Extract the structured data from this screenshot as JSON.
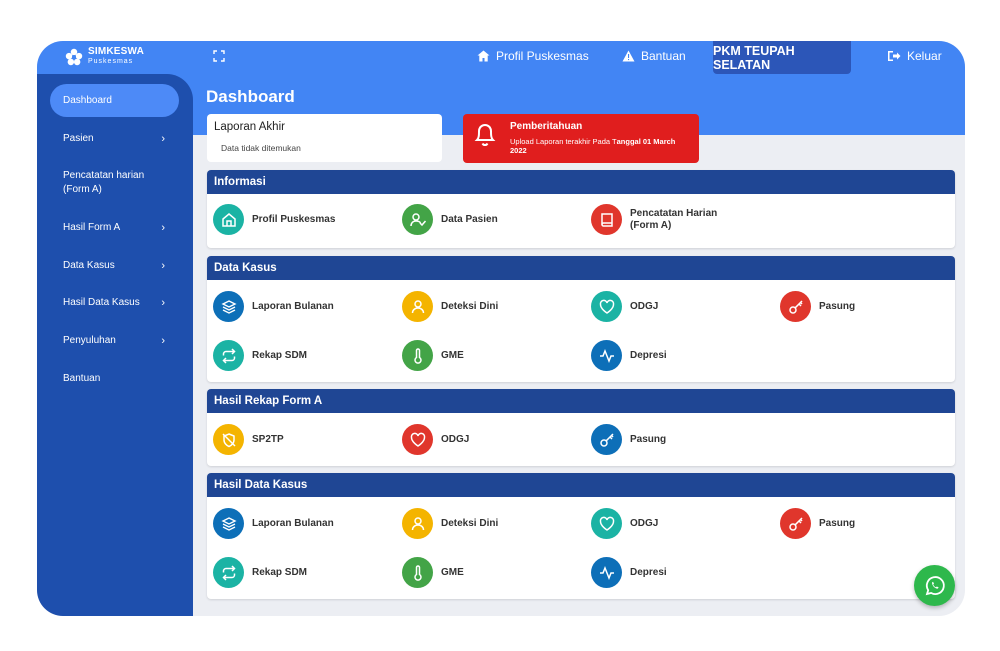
{
  "header": {
    "brand_title": "SIMKESWA",
    "brand_sub": "Puskesmas",
    "nav_profil": "Profil Puskesmas",
    "nav_bantuan": "Bantuan",
    "pkm": "PKM TEUPAH SELATAN",
    "nav_keluar": "Keluar"
  },
  "sidebar": {
    "items": [
      {
        "label": "Dashboard"
      },
      {
        "label": "Pasien"
      },
      {
        "label": "Pencatatan harian\n(Form A)"
      },
      {
        "label": "Hasil Form A"
      },
      {
        "label": "Data Kasus"
      },
      {
        "label": "Hasil Data Kasus"
      },
      {
        "label": "Penyuluhan"
      },
      {
        "label": "Bantuan"
      }
    ],
    "chevron": "›"
  },
  "main": {
    "title": "Dashboard",
    "laporan": {
      "title": "Laporan Akhir",
      "text": "Data tidak ditemukan"
    },
    "notif": {
      "title": "Pemberitahuan",
      "text_a": "Upload Laporan terakhir Pada T",
      "text_b": "anggal 01 March 2022"
    }
  },
  "panels": {
    "informasi": {
      "title": "Informasi",
      "items": [
        "Profil Puskesmas",
        "Data Pasien",
        "Pencatatan Harian\n(Form A)"
      ]
    },
    "data_kasus": {
      "title": "Data Kasus",
      "items": [
        "Laporan Bulanan",
        "Deteksi Dini",
        "ODGJ",
        "Pasung",
        "Rekap SDM",
        "GME",
        "Depresi"
      ]
    },
    "rekap_form_a": {
      "title": "Hasil Rekap Form A",
      "items": [
        "SP2TP",
        "ODGJ",
        "Pasung"
      ]
    },
    "hasil_data_kasus": {
      "title": "Hasil Data Kasus",
      "items": [
        "Laporan Bulanan",
        "Deteksi Dini",
        "ODGJ",
        "Pasung",
        "Rekap SDM",
        "GME",
        "Depresi"
      ]
    }
  },
  "colors": {
    "topbar": "#4285f4",
    "sidebar": "#1e4fad",
    "panel_head": "#1f4694",
    "teal": "#1bb3a4",
    "green": "#43a447",
    "red": "#e0362c",
    "blue": "#0d6fb8",
    "yellow": "#f4b400"
  },
  "icons": {
    "profil": "home-icon",
    "data_pasien": "user-check-icon",
    "pencatatan": "book-icon",
    "laporan": "layers-icon",
    "deteksi": "user-icon",
    "odgj": "heart-icon",
    "pasung": "key-icon",
    "rekap": "repeat-icon",
    "gme": "thermometer-icon",
    "depresi": "activity-icon",
    "sp2tp": "slash-icon",
    "whatsapp": "whatsapp-icon"
  }
}
